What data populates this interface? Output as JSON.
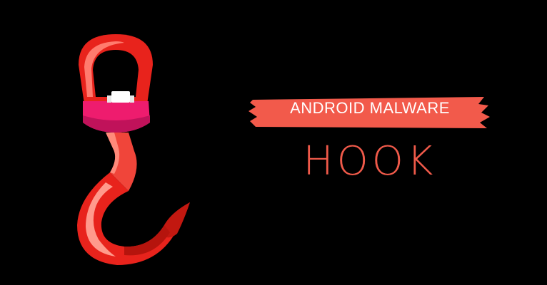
{
  "banner": {
    "text": "ANDROID MALWARE"
  },
  "headline": {
    "text": "HOOK"
  },
  "colors": {
    "background": "#000000",
    "banner_fill": "#f25a4b",
    "headline": "#f05a4a",
    "hook_red": "#e8231c",
    "hook_pink": "#ee1c6e",
    "hook_highlight": "#ff8a7a"
  },
  "icons": {
    "illustration": "crane-hook-icon"
  }
}
